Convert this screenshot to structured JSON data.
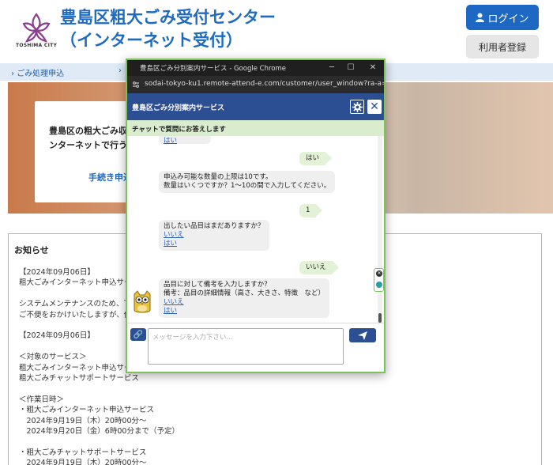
{
  "header": {
    "logo_text": "TOSHIMA CITY",
    "title_line1": "豊島区粗大ごみ受付センター",
    "title_line2": "（インターネット受付）",
    "login_label": "ログイン",
    "register_label": "利用者登録"
  },
  "nav": {
    "items": [
      {
        "label": "ごみ処理申込"
      }
    ]
  },
  "hero": {
    "line1": "豊島区の粗大ごみ収",
    "line2": "ンターネットで行う",
    "link": "手続き申込"
  },
  "notices": {
    "title": "お知らせ",
    "lines": [
      "【2024年09月06日】",
      "粗大ごみインターネット申込サー",
      "",
      "システムメンテナンスのため、下",
      "ご不便をおかけいたしますが、依",
      "",
      "【2024年09月06日】",
      "",
      "＜対象のサービス＞",
      "粗大ごみインターネット申込サー",
      "粗大ごみチャットサポートサービス",
      "",
      "＜作業日時＞",
      "・粗大ごみインターネット申込サービス",
      "　2024年9月19日（木）20時00分～",
      "　2024年9月20日（金）6時00分まで（予定）",
      "",
      "・粗大ごみチャットサポートサービス",
      "　2024年9月19日（木）20時00分～"
    ]
  },
  "chrome": {
    "window_title": "豊島区ごみ分別案内サービス - Google Chrome",
    "url": "sodai-tokyo-ku1.remote-attend-e.com/customer/user_window?ra-a=..."
  },
  "chat": {
    "title": "豊島区ごみ分別案内サービス",
    "subtitle": "チャットで質問にお答えします",
    "partial_link": "はい",
    "user_msg1": "はい",
    "bot_msg1_line1": "申込み可能な数量の上限は10です。",
    "bot_msg1_line2": "数量はいくつですか？1～10の間で入力してください。",
    "user_msg2": "1",
    "bot_msg2_line1": "出したい品目はまだありますか？",
    "bot_msg2_opt1": "いいえ",
    "bot_msg2_opt2": "はい",
    "user_msg3": "いいえ",
    "bot_msg3_line1": "品目に対して備考を入力しますか？",
    "bot_msg3_line2": "備考：品目の詳細情報（高さ、大きさ、特徴　など）",
    "bot_msg3_opt1": "いいえ",
    "bot_msg3_opt2": "はい",
    "input_placeholder": "メッセージを入力下さい..."
  }
}
